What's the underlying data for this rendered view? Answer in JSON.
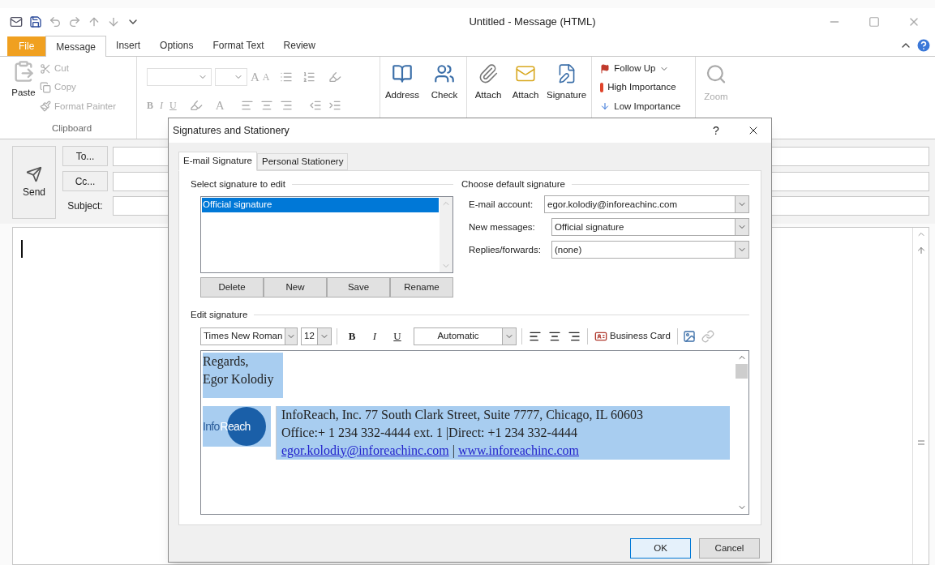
{
  "window": {
    "title": "Untitled - Message (HTML)"
  },
  "ribbon_tabs": [
    {
      "label": "File",
      "kind": "file",
      "selected": false
    },
    {
      "label": "Message",
      "kind": "tab",
      "selected": true
    },
    {
      "label": "Insert",
      "kind": "tab",
      "selected": false
    },
    {
      "label": "Options",
      "kind": "tab",
      "selected": false
    },
    {
      "label": "Format Text",
      "kind": "tab",
      "selected": false
    },
    {
      "label": "Review",
      "kind": "tab",
      "selected": false
    }
  ],
  "clipboard": {
    "paste": "Paste",
    "items": [
      {
        "label": "Cut",
        "kind": "cut"
      },
      {
        "label": "Copy",
        "kind": "copy"
      },
      {
        "label": "Format Painter",
        "kind": "painter"
      }
    ],
    "label": "Clipboard"
  },
  "basic_text": {
    "disabled": true,
    "grow": "A",
    "shrink": "A",
    "styles": [
      "B",
      "I",
      "U"
    ],
    "font_color_glyph": "A"
  },
  "names": [
    {
      "label": "Address",
      "kind": "book"
    },
    {
      "label": "Check",
      "kind": "people"
    }
  ],
  "include": [
    {
      "label": "Attach",
      "kind": "clip"
    },
    {
      "label": "Attach",
      "kind": "envelope"
    },
    {
      "label": "Signature",
      "kind": "pen"
    }
  ],
  "tags": [
    {
      "label": "Follow Up",
      "kind": "flag",
      "dropdown": true
    },
    {
      "label": "High Importance",
      "kind": "high",
      "dropdown": false
    },
    {
      "label": "Low Importance",
      "kind": "low",
      "dropdown": false
    }
  ],
  "zoom": {
    "label": "Zoom",
    "disabled": true
  },
  "compose": {
    "send": "Send",
    "fields": [
      {
        "label": "To...",
        "kind": "button"
      },
      {
        "label": "Cc...",
        "kind": "button"
      },
      {
        "label": "Subject:",
        "kind": "label"
      }
    ]
  },
  "dialog": {
    "title": "Signatures and Stationery",
    "help": "?",
    "tabs": [
      {
        "label": "E-mail Signature",
        "selected": true
      },
      {
        "label": "Personal Stationery",
        "selected": false
      }
    ],
    "select_label": "Select signature to edit",
    "signatures": [
      {
        "name": "Official signature",
        "selected": true
      }
    ],
    "buttons": [
      "Delete",
      "New",
      "Save",
      "Rename"
    ],
    "default_label": "Choose default signature",
    "defaults": [
      {
        "label": "E-mail account:",
        "value": "egor.kolodiy@inforeachinc.com"
      },
      {
        "label": "New messages:",
        "value": "Official signature"
      },
      {
        "label": "Replies/forwards:",
        "value": "(none)"
      }
    ],
    "edit_label": "Edit signature",
    "toolbar": {
      "font": "Times New Roman",
      "size": "12",
      "styles": [
        "B",
        "I",
        "U"
      ],
      "color_setting": "Automatic",
      "business_card": "Business Card"
    },
    "signature": {
      "selected": true,
      "lines": [
        "Regards,",
        "Egor Kolodiy"
      ],
      "logo": {
        "left": "Info",
        "right": "Reach"
      },
      "details": [
        "InfoReach, Inc. 77 South Clark Street, Suite 7777, Chicago, IL 60603",
        "Office:+ 1 234 332-4444 ext. 1 |Direct: +1 234 332-4444"
      ],
      "links": [
        "egor.kolodiy@inforeachinc.com",
        "www.inforeachinc.com"
      ],
      "separator": "|"
    },
    "ok": "OK",
    "cancel": "Cancel"
  }
}
